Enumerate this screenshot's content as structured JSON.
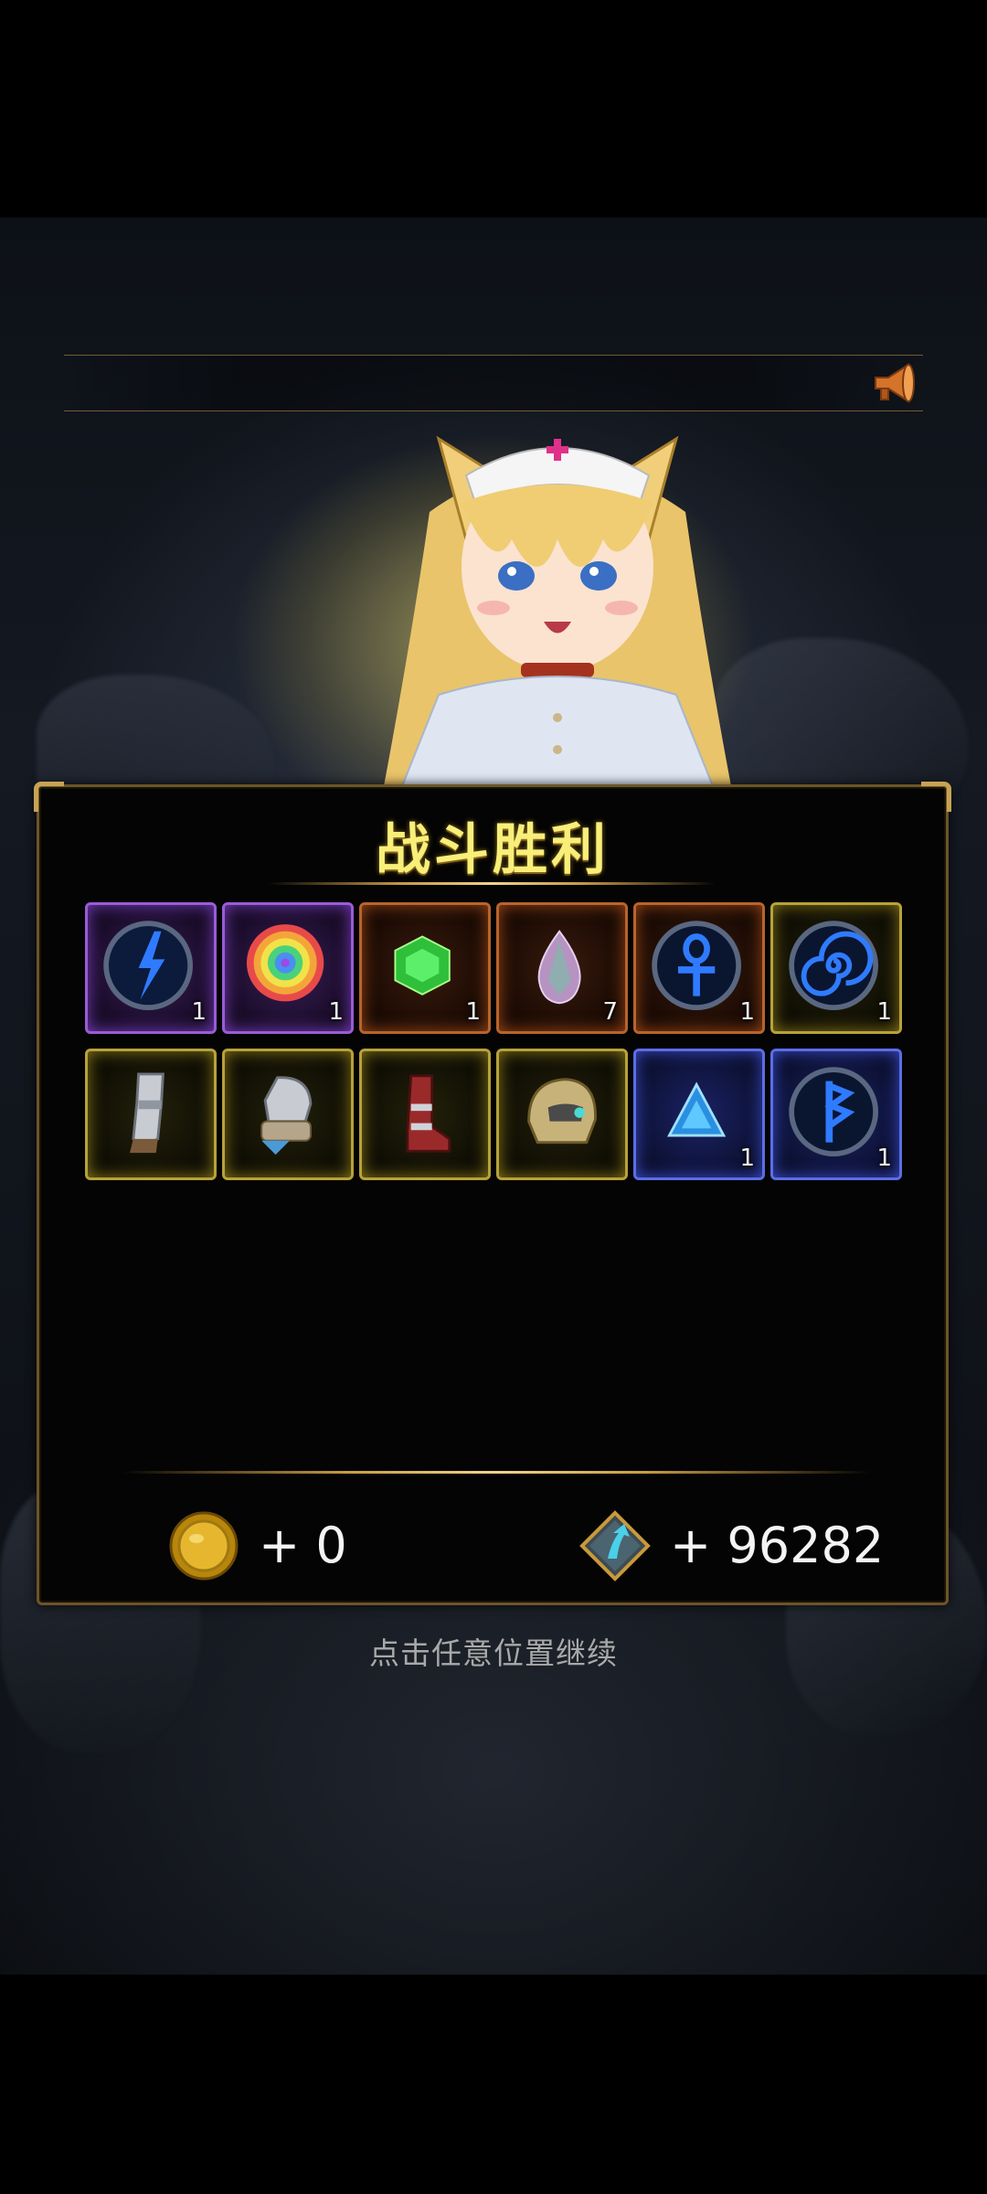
{
  "colors": {
    "title": "#f7ef7a",
    "panel_border": "#6b5528",
    "hint_text": "#a9a9a9"
  },
  "notice_bar": {
    "icon": "megaphone-icon"
  },
  "panel": {
    "title": "战斗胜利",
    "items": [
      {
        "icon": "lightning-orb-icon",
        "rarity": "purple",
        "count": "1"
      },
      {
        "icon": "rainbow-swirl-icon",
        "rarity": "purple",
        "count": "1"
      },
      {
        "icon": "green-gem-icon",
        "rarity": "orange",
        "count": "1"
      },
      {
        "icon": "pink-crystal-icon",
        "rarity": "orange",
        "count": "7"
      },
      {
        "icon": "ankh-rune-icon",
        "rarity": "orange",
        "count": "1"
      },
      {
        "icon": "spiral-rune-icon",
        "rarity": "gold",
        "count": "1"
      },
      {
        "icon": "armored-leg-icon",
        "rarity": "gold",
        "count": ""
      },
      {
        "icon": "armored-gauntlet-icon",
        "rarity": "gold",
        "count": ""
      },
      {
        "icon": "red-boot-icon",
        "rarity": "gold",
        "count": ""
      },
      {
        "icon": "ornate-helmet-icon",
        "rarity": "gold",
        "count": ""
      },
      {
        "icon": "blue-triangle-crystal-icon",
        "rarity": "blue",
        "count": "1"
      },
      {
        "icon": "bolt-rune-icon",
        "rarity": "blue",
        "count": "1"
      }
    ],
    "gold_reward": {
      "icon": "gold-coin-icon",
      "text": "+ 0"
    },
    "exp_reward": {
      "icon": "exp-up-icon",
      "text": "+ 96282"
    }
  },
  "continue_hint": "点击任意位置继续"
}
